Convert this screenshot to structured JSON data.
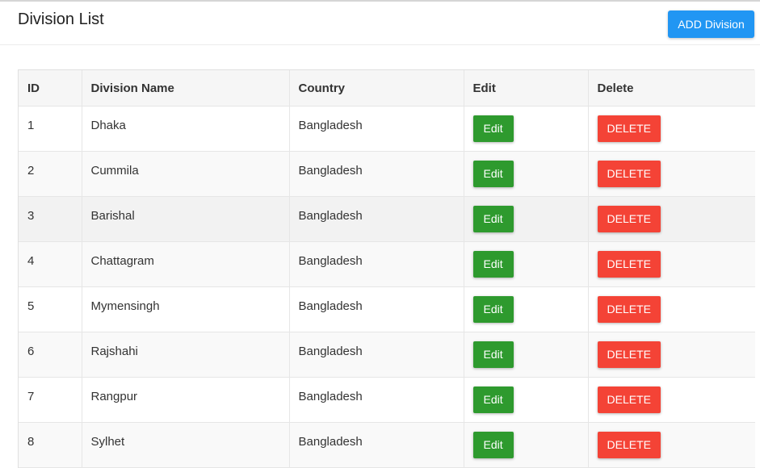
{
  "header": {
    "title": "Division List",
    "add_button_label": "ADD Division"
  },
  "table": {
    "columns": [
      "ID",
      "Division Name",
      "Country",
      "Edit",
      "Delete"
    ],
    "edit_label": "Edit",
    "delete_label": "DELETE",
    "rows": [
      {
        "id": "1",
        "name": "Dhaka",
        "country": "Bangladesh"
      },
      {
        "id": "2",
        "name": "Cummila",
        "country": "Bangladesh"
      },
      {
        "id": "3",
        "name": "Barishal",
        "country": "Bangladesh"
      },
      {
        "id": "4",
        "name": "Chattagram",
        "country": "Bangladesh"
      },
      {
        "id": "5",
        "name": "Mymensingh",
        "country": "Bangladesh"
      },
      {
        "id": "6",
        "name": "Rajshahi",
        "country": "Bangladesh"
      },
      {
        "id": "7",
        "name": "Rangpur",
        "country": "Bangladesh"
      },
      {
        "id": "8",
        "name": "Sylhet",
        "country": "Bangladesh"
      }
    ]
  },
  "colors": {
    "add_button": "#2196f3",
    "edit_button": "#2e9a2e",
    "delete_button": "#f44336"
  }
}
